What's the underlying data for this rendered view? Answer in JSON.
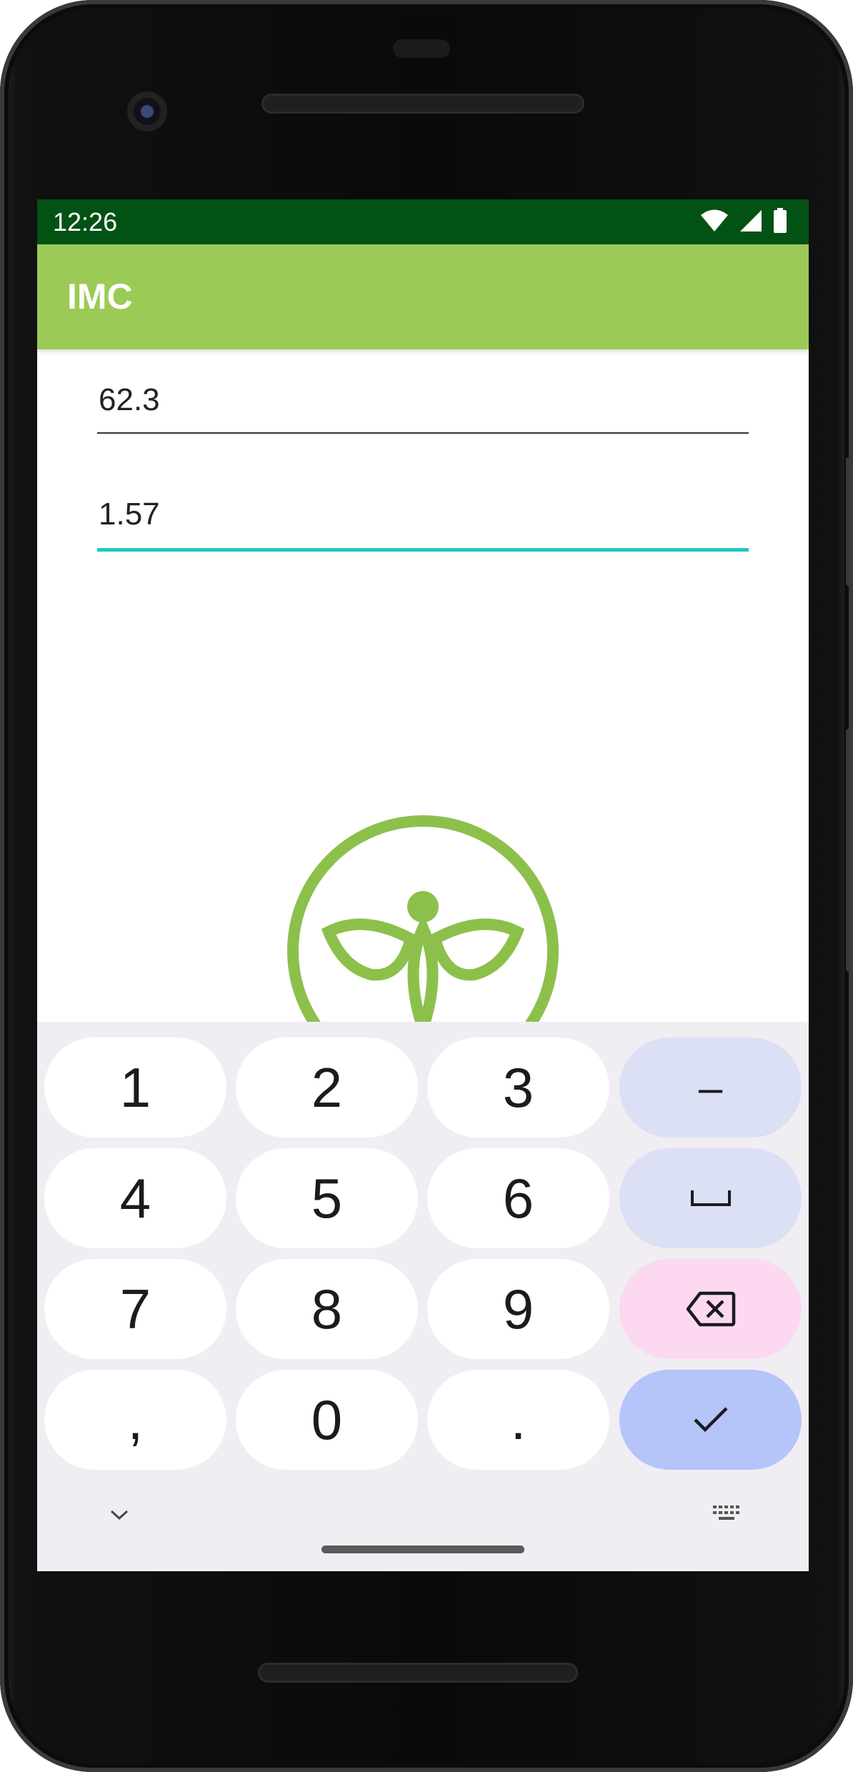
{
  "status_bar": {
    "time": "12:26",
    "icons": [
      "wifi-icon",
      "cell-signal-icon",
      "battery-icon"
    ],
    "background": "#015214"
  },
  "app_bar": {
    "title": "IMC",
    "background": "#9bcb56"
  },
  "form": {
    "weight_value": "62.3",
    "height_value": "1.57",
    "focus_color": "#1fc7c0"
  },
  "logo": {
    "icon": "leaf-figure-logo",
    "color": "#8cc04b"
  },
  "keyboard": {
    "rows": [
      [
        "1",
        "2",
        "3",
        "–"
      ],
      [
        "4",
        "5",
        "6",
        "␣"
      ],
      [
        "7",
        "8",
        "9",
        "⌫"
      ],
      [
        ",",
        "0",
        ".",
        "✓"
      ]
    ],
    "fn_color": "#dbe0f4",
    "delete_color": "#fcd8f1",
    "done_color": "#b5c4f9",
    "hide_icon": "chevron-down-icon",
    "switch_icon": "keyboard-icon"
  }
}
